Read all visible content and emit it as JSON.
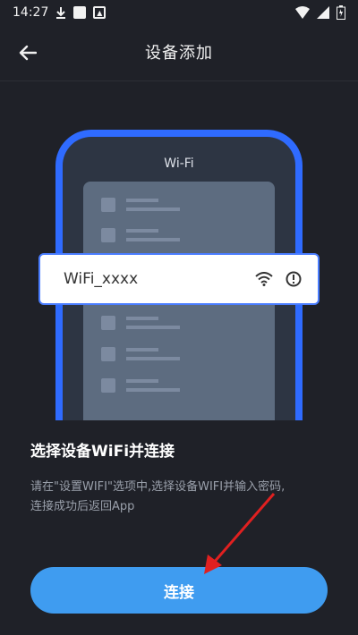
{
  "status_bar": {
    "time": "14:27"
  },
  "header": {
    "title": "设备添加"
  },
  "illustration": {
    "phone_label": "Wi-Fi",
    "wifi_name": "WiFi_xxxx"
  },
  "instructions": {
    "heading": "选择设备WiFi并连接",
    "line1": "请在\"设置WIFI\"选项中,选择设备WIFI并输入密码,",
    "line2": "连接成功后返回App"
  },
  "actions": {
    "connect_label": "连接"
  },
  "colors": {
    "background": "#1f2128",
    "accent_blue": "#2f6bff",
    "button_blue": "#3f9cf0",
    "arrow_red": "#e02020"
  }
}
